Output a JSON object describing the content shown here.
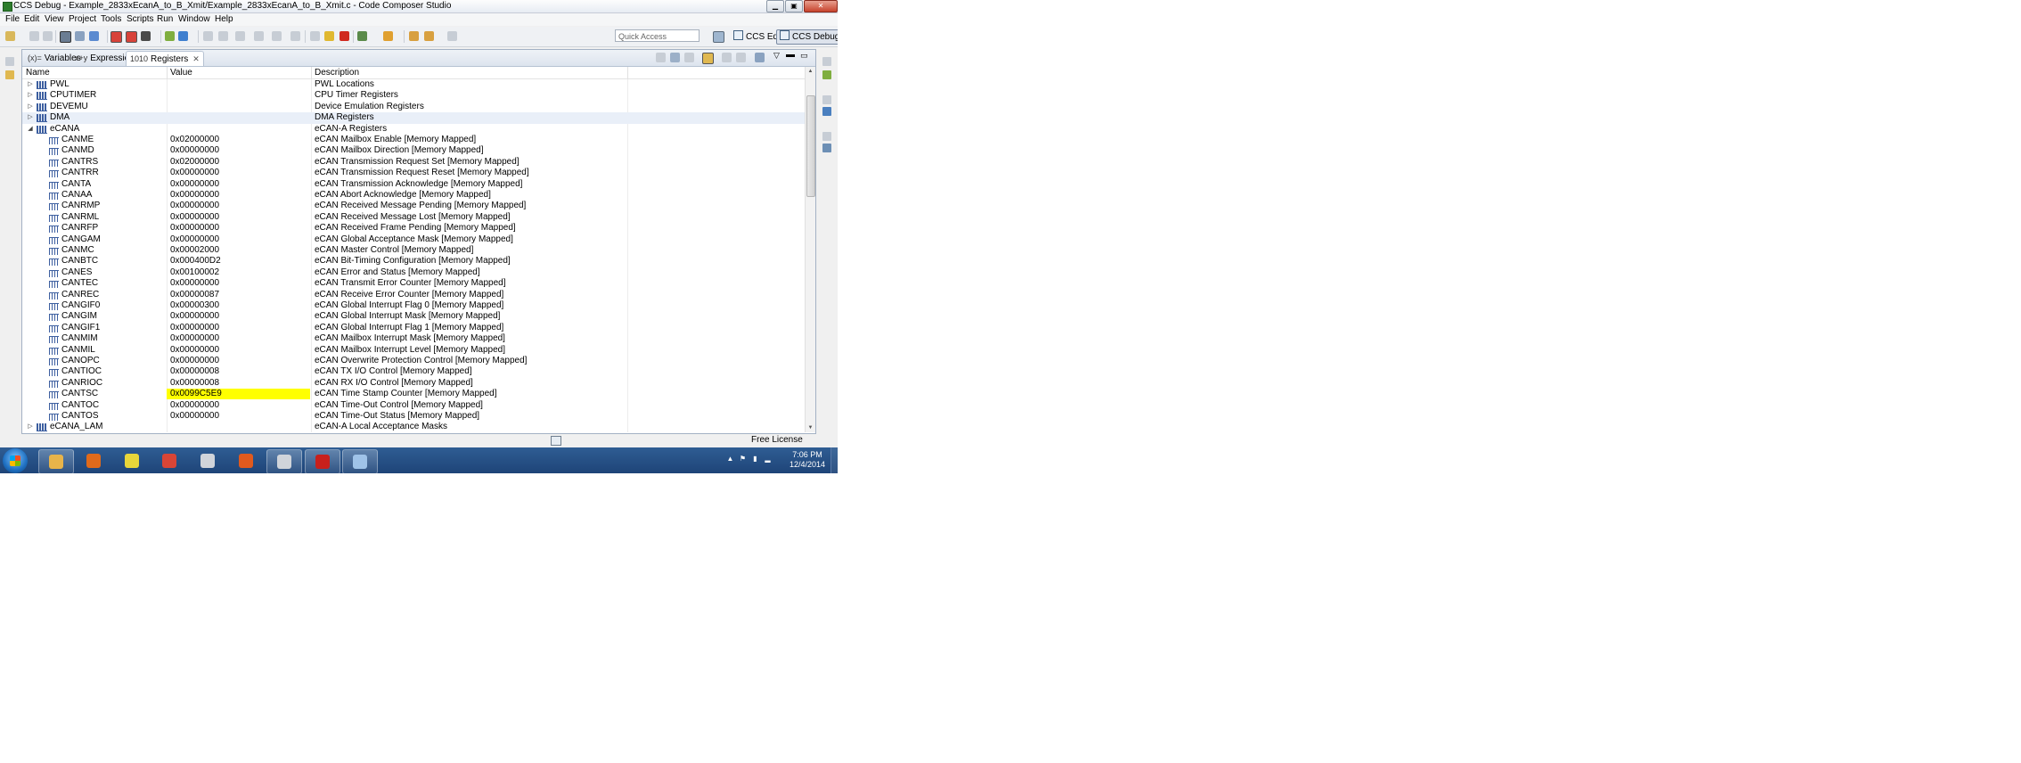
{
  "window": {
    "title": "CCS Debug - Example_2833xEcanA_to_B_Xmit/Example_2833xEcanA_to_B_Xmit.c - Code Composer Studio",
    "min": "0",
    "max": "1",
    "close": "r"
  },
  "menu": [
    "File",
    "Edit",
    "View",
    "Project",
    "Tools",
    "Scripts",
    "Run",
    "Window",
    "Help"
  ],
  "toolbar": {
    "quick_access_placeholder": "Quick Access",
    "perspectives": [
      {
        "label": "CCS Edit",
        "active": false
      },
      {
        "label": "CCS Debug",
        "active": true
      }
    ]
  },
  "tabs": [
    {
      "label": "Variables",
      "icon": "(x)=",
      "active": false
    },
    {
      "label": "Expressions",
      "icon": "x+y",
      "active": false
    },
    {
      "label": "Registers",
      "icon": "1010",
      "active": true
    }
  ],
  "columns": [
    "Name",
    "Value",
    "Description"
  ],
  "rows": [
    {
      "level": 0,
      "expander": "▷",
      "name": "PWL",
      "value": "",
      "desc": "PWL Locations"
    },
    {
      "level": 0,
      "expander": "▷",
      "name": "CPUTIMER",
      "value": "",
      "desc": "CPU Timer Registers"
    },
    {
      "level": 0,
      "expander": "▷",
      "name": "DEVEMU",
      "value": "",
      "desc": "Device Emulation Registers"
    },
    {
      "level": 0,
      "expander": "▷",
      "name": "DMA",
      "value": "",
      "desc": "DMA Registers",
      "selected": true
    },
    {
      "level": 0,
      "expander": "◢",
      "name": "eCANA",
      "value": "",
      "desc": "eCAN-A  Registers"
    },
    {
      "level": 1,
      "name": "CANME",
      "value": "0x02000000",
      "desc": "eCAN Mailbox Enable [Memory Mapped]"
    },
    {
      "level": 1,
      "name": "CANMD",
      "value": "0x00000000",
      "desc": "eCAN Mailbox Direction [Memory Mapped]"
    },
    {
      "level": 1,
      "name": "CANTRS",
      "value": "0x02000000",
      "desc": "eCAN Transmission Request Set [Memory Mapped]"
    },
    {
      "level": 1,
      "name": "CANTRR",
      "value": "0x00000000",
      "desc": "eCAN Transmission Request Reset [Memory Mapped]"
    },
    {
      "level": 1,
      "name": "CANTA",
      "value": "0x00000000",
      "desc": "eCAN Transmission Acknowledge [Memory Mapped]"
    },
    {
      "level": 1,
      "name": "CANAA",
      "value": "0x00000000",
      "desc": "eCAN Abort Acknowledge [Memory Mapped]"
    },
    {
      "level": 1,
      "name": "CANRMP",
      "value": "0x00000000",
      "desc": "eCAN Received Message Pending [Memory Mapped]"
    },
    {
      "level": 1,
      "name": "CANRML",
      "value": "0x00000000",
      "desc": "eCAN Received Message Lost [Memory Mapped]"
    },
    {
      "level": 1,
      "name": "CANRFP",
      "value": "0x00000000",
      "desc": "eCAN Received Frame Pending [Memory Mapped]"
    },
    {
      "level": 1,
      "name": "CANGAM",
      "value": "0x00000000",
      "desc": "eCAN Global Acceptance Mask [Memory Mapped]"
    },
    {
      "level": 1,
      "name": "CANMC",
      "value": "0x00002000",
      "desc": "eCAN Master Control [Memory Mapped]"
    },
    {
      "level": 1,
      "name": "CANBTC",
      "value": "0x000400D2",
      "desc": "eCAN Bit-Timing Configuration [Memory Mapped]"
    },
    {
      "level": 1,
      "name": "CANES",
      "value": "0x00100002",
      "desc": "eCAN Error and Status [Memory Mapped]"
    },
    {
      "level": 1,
      "name": "CANTEC",
      "value": "0x00000000",
      "desc": "eCAN Transmit Error Counter [Memory Mapped]"
    },
    {
      "level": 1,
      "name": "CANREC",
      "value": "0x00000087",
      "desc": "eCAN Receive Error Counter [Memory Mapped]"
    },
    {
      "level": 1,
      "name": "CANGIF0",
      "value": "0x00000300",
      "desc": "eCAN Global Interrupt Flag 0 [Memory Mapped]"
    },
    {
      "level": 1,
      "name": "CANGIM",
      "value": "0x00000000",
      "desc": "eCAN Global Interrupt Mask [Memory Mapped]"
    },
    {
      "level": 1,
      "name": "CANGIF1",
      "value": "0x00000000",
      "desc": "eCAN Global Interrupt Flag 1 [Memory Mapped]"
    },
    {
      "level": 1,
      "name": "CANMIM",
      "value": "0x00000000",
      "desc": "eCAN Mailbox Interrupt Mask [Memory Mapped]"
    },
    {
      "level": 1,
      "name": "CANMIL",
      "value": "0x00000000",
      "desc": "eCAN Mailbox Interrupt Level [Memory Mapped]"
    },
    {
      "level": 1,
      "name": "CANOPC",
      "value": "0x00000000",
      "desc": "eCAN Overwrite Protection Control [Memory Mapped]"
    },
    {
      "level": 1,
      "name": "CANTIOC",
      "value": "0x00000008",
      "desc": "eCAN TX I/O Control [Memory Mapped]"
    },
    {
      "level": 1,
      "name": "CANRIOC",
      "value": "0x00000008",
      "desc": "eCAN RX I/O Control [Memory Mapped]"
    },
    {
      "level": 1,
      "name": "CANTSC",
      "value": "0x0099C5E9",
      "desc": "eCAN Time Stamp Counter [Memory Mapped]",
      "highlight": true
    },
    {
      "level": 1,
      "name": "CANTOC",
      "value": "0x00000000",
      "desc": "eCAN Time-Out Control [Memory Mapped]"
    },
    {
      "level": 1,
      "name": "CANTOS",
      "value": "0x00000000",
      "desc": "eCAN Time-Out Status [Memory Mapped]"
    },
    {
      "level": 0,
      "expander": "▷",
      "name": "eCANA_LAM",
      "value": "",
      "desc": "eCAN-A Local Acceptance Masks"
    }
  ],
  "status": {
    "license": "Free License"
  },
  "taskbar": {
    "apps": [
      {
        "name": "explorer",
        "color": "#e8b44a",
        "pinned": true
      },
      {
        "name": "firefox",
        "color": "#e06a1b",
        "pinned": false
      },
      {
        "name": "app-yellow-eye",
        "color": "#e8d63a",
        "pinned": false
      },
      {
        "name": "chrome",
        "color": "#d94536",
        "pinned": false
      },
      {
        "name": "cube-app",
        "color": "#d0d4da",
        "pinned": false
      },
      {
        "name": "matlab",
        "color": "#e05a1e",
        "pinned": false
      },
      {
        "name": "cube-app-2",
        "color": "#d0d4da",
        "pinned": true
      },
      {
        "name": "acrobat",
        "color": "#c8201c",
        "pinned": true
      },
      {
        "name": "ccs",
        "color": "#9fc3e8",
        "pinned": true
      }
    ],
    "tray_icons": [
      "▲",
      "⚑",
      "▮",
      "▂"
    ],
    "time": "7:06 PM",
    "date": "12/4/2014"
  }
}
